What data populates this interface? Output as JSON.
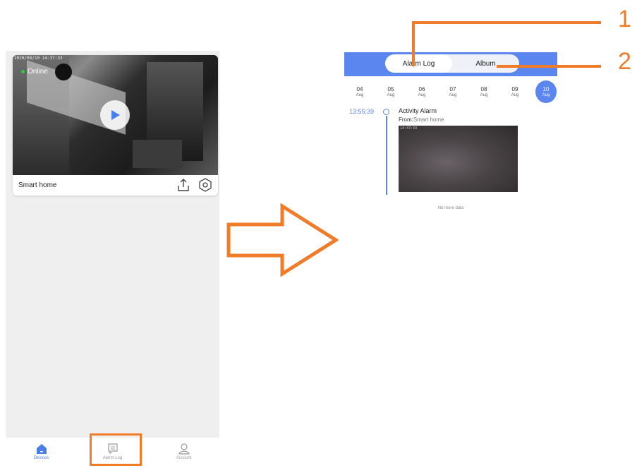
{
  "left_screen": {
    "camera": {
      "timestamp": "2020/08/10 14:37:33",
      "online_label": "Online",
      "device_name": "Smart home"
    },
    "nav": [
      {
        "label": "Devices",
        "icon": "home-icon",
        "active": true
      },
      {
        "label": "Alarm Log",
        "icon": "message-icon",
        "active": false
      },
      {
        "label": "Account",
        "icon": "user-icon",
        "active": false
      }
    ]
  },
  "right_screen": {
    "tabs": [
      {
        "label": "Alarm Log",
        "active": true
      },
      {
        "label": "Album",
        "active": false
      }
    ],
    "dates": [
      {
        "day": "04",
        "month": "Aug"
      },
      {
        "day": "05",
        "month": "Aug"
      },
      {
        "day": "06",
        "month": "Aug"
      },
      {
        "day": "07",
        "month": "Aug"
      },
      {
        "day": "08",
        "month": "Aug"
      },
      {
        "day": "09",
        "month": "Aug"
      },
      {
        "day": "10",
        "month": "Aug",
        "active": true
      }
    ],
    "alarm": {
      "time": "13:55:39",
      "title": "Activity Alarm",
      "from_label": "From:",
      "from_value": "Smart home",
      "thumb_time": "14:37:33"
    },
    "footer_note": "No more data"
  },
  "callouts": {
    "one": "1",
    "two": "2"
  },
  "colors": {
    "accent": "#5b86f0",
    "highlight": "#f07c2a",
    "online": "#2ecc40"
  }
}
